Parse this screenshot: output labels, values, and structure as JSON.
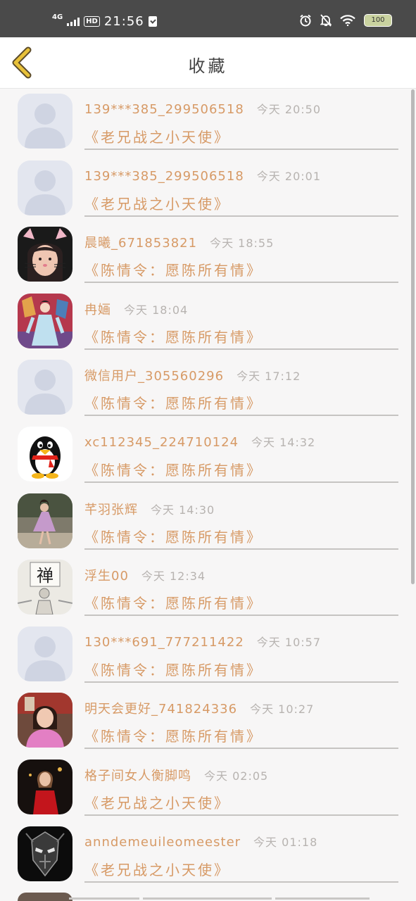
{
  "status_bar": {
    "network": "4G",
    "hd": "HD",
    "time": "21:56",
    "battery": "100"
  },
  "header": {
    "title": "收藏"
  },
  "colors": {
    "accent": "#d79a66",
    "back_arrow": "#e8c13a",
    "muted": "#b7b3b0"
  },
  "favorites": [
    {
      "username": "139***385_299506518",
      "time": "今天 20:50",
      "title": "《老兄战之小天使》",
      "avatar": "placeholder"
    },
    {
      "username": "139***385_299506518",
      "time": "今天 20:01",
      "title": "《老兄战之小天使》",
      "avatar": "placeholder"
    },
    {
      "username": "晨曦_671853821",
      "time": "今天 18:55",
      "title": "《陈情令：愿陈所有情》",
      "avatar": "cat-filter-photo"
    },
    {
      "username": "冉婳",
      "time": "今天 18:04",
      "title": "《陈情令：愿陈所有情》",
      "avatar": "costume-illustration"
    },
    {
      "username": "微信用户_305560296",
      "time": "今天 17:12",
      "title": "《陈情令：愿陈所有情》",
      "avatar": "placeholder"
    },
    {
      "username": "xc112345_224710124",
      "time": "今天 14:32",
      "title": "《陈情令：愿陈所有情》",
      "avatar": "qq-penguin"
    },
    {
      "username": "芊羽张辉",
      "time": "今天 14:30",
      "title": "《陈情令：愿陈所有情》",
      "avatar": "dancer-photo"
    },
    {
      "username": "浮生00",
      "time": "今天 12:34",
      "title": "《陈情令：愿陈所有情》",
      "avatar": "zen-sketch",
      "avatar_text": "禅"
    },
    {
      "username": "130***691_777211422",
      "time": "今天 10:57",
      "title": "《陈情令：愿陈所有情》",
      "avatar": "placeholder"
    },
    {
      "username": "明天会更好_741824336",
      "time": "今天 10:27",
      "title": "《陈情令：愿陈所有情》",
      "avatar": "woman-pink-photo"
    },
    {
      "username": "格子间女人衡脚鸣",
      "time": "今天 02:05",
      "title": "《老兄战之小天使》",
      "avatar": "woman-red-photo"
    },
    {
      "username": "anndemeuileomeester",
      "time": "今天 01:18",
      "title": "《老兄战之小天使》",
      "avatar": "dark-mask"
    }
  ]
}
